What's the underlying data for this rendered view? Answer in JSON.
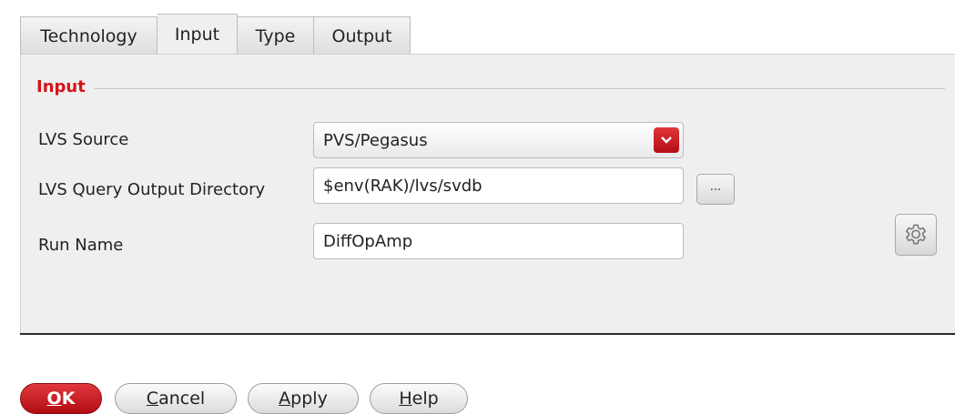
{
  "tabs": [
    {
      "label": "Technology",
      "active": false
    },
    {
      "label": "Input",
      "active": true
    },
    {
      "label": "Type",
      "active": false
    },
    {
      "label": "Output",
      "active": false
    }
  ],
  "group": {
    "title": "Input",
    "title_color": "#d3141b"
  },
  "lvs_source": {
    "label": "LVS Source",
    "value": "PVS/Pegasus",
    "arrow_icon": "chevron-down-icon"
  },
  "lvs_query_dir": {
    "label": "LVS Query Output Directory",
    "value": "$env(RAK)/lvs/svdb",
    "browse_label": "..."
  },
  "run_name": {
    "label": "Run Name",
    "value": "DiffOpAmp",
    "settings_icon": "gear-icon"
  },
  "buttons": {
    "ok": {
      "mnemonic": "O",
      "rest": "K"
    },
    "cancel": {
      "mnemonic": "C",
      "rest": "ancel"
    },
    "apply": {
      "mnemonic": "A",
      "rest": "pply"
    },
    "help": {
      "mnemonic": "H",
      "rest": "elp"
    }
  },
  "colors": {
    "accent_red": "#c4141a",
    "panel_bg": "#efefef"
  }
}
